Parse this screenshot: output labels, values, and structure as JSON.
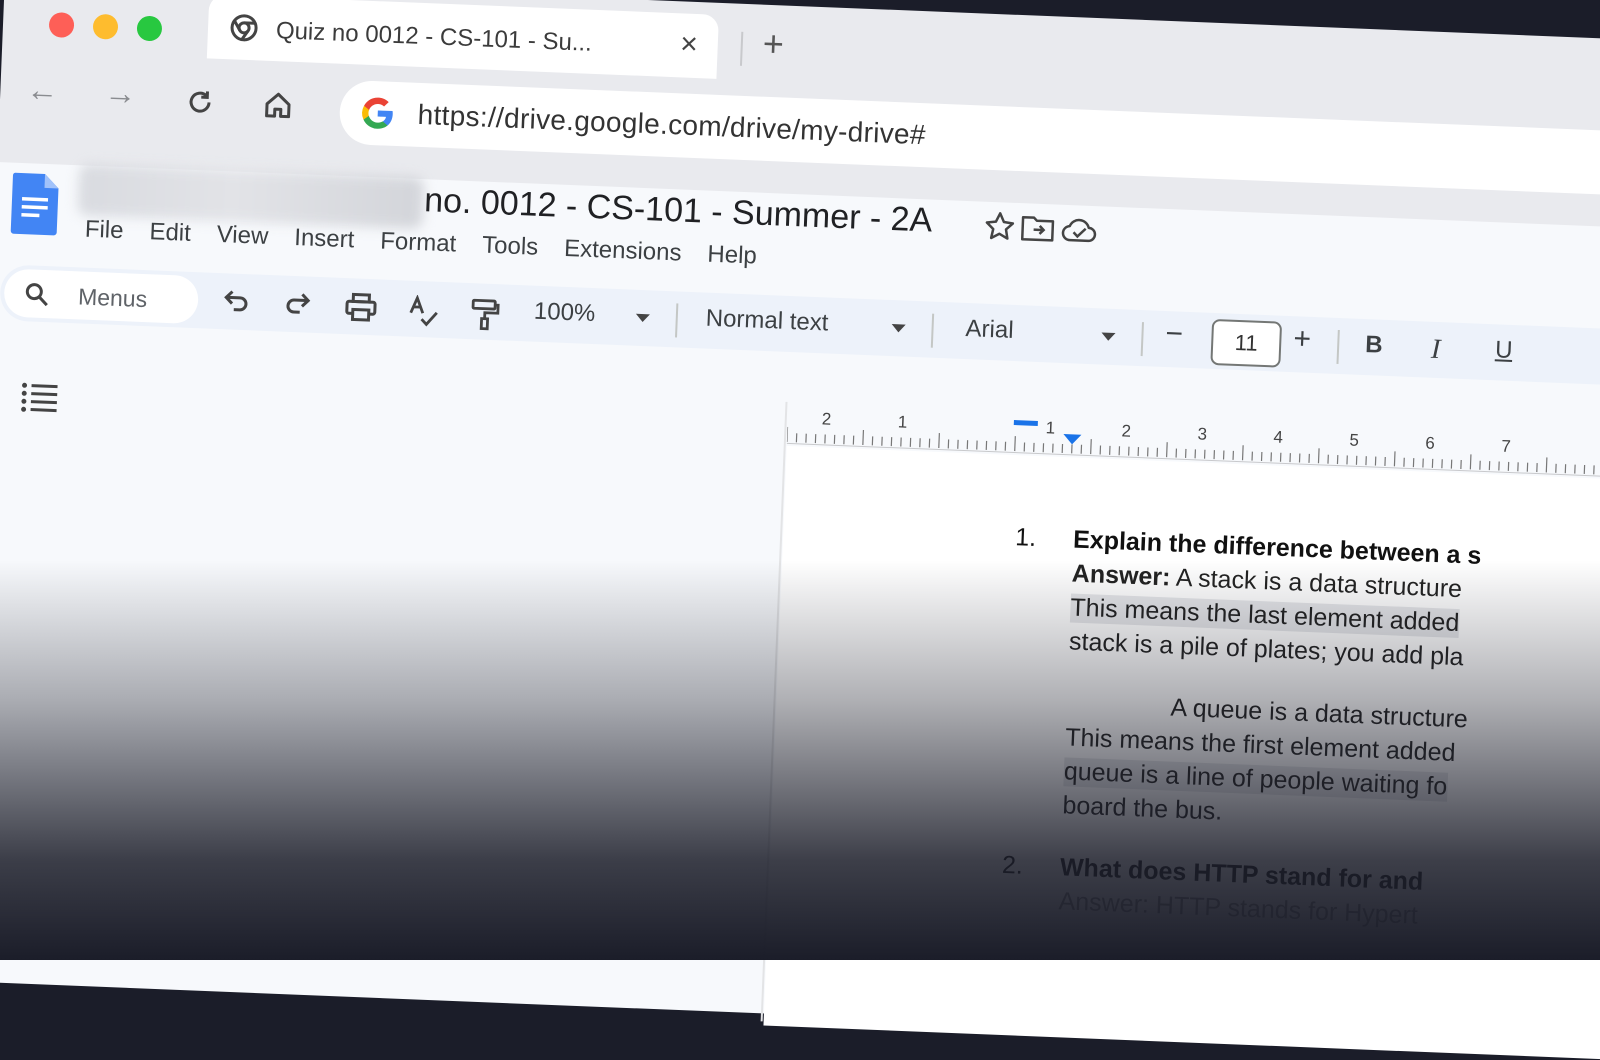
{
  "browser": {
    "tab_title": "Quiz no 0012 - CS-101 - Su...",
    "tab_close": "×",
    "new_tab": "+",
    "back": "←",
    "forward": "→",
    "url": "https://drive.google.com/drive/my-drive#"
  },
  "doc": {
    "title": "no. 0012 - CS-101 - Summer - 2A",
    "menu": [
      "File",
      "Edit",
      "View",
      "Insert",
      "Format",
      "Tools",
      "Extensions",
      "Help"
    ]
  },
  "toolbar": {
    "menus_label": "Menus",
    "zoom": "100%",
    "style": "Normal text",
    "font": "Arial",
    "font_size": "11",
    "minus": "−",
    "plus": "+",
    "bold": "B",
    "italic": "I",
    "underline": "U"
  },
  "ruler": {
    "labels": [
      "2",
      "1",
      "1",
      "2",
      "3",
      "4",
      "5",
      "6",
      "7"
    ]
  },
  "content": {
    "q1_number": "1.",
    "q1_text": "Explain the difference between a s",
    "answer_label": "Answer:",
    "q1_line1": " A stack is a data structure",
    "q1_line2": "This means the last element added",
    "q1_line3": "stack is a pile of plates; you add pla",
    "q1_line4": "A queue is a data structure",
    "q1_line5": "This means the first element added",
    "q1_line6": "queue is a line of people waiting fo",
    "q1_line7": "board the bus.",
    "q2_number": "2.",
    "q2_text": "What does HTTP stand for and",
    "q2_answer": "Answer: HTTP stands for Hypert"
  },
  "colors": {
    "background": "#1b1d29",
    "docs_blue": "#4285f4",
    "toolbar_bg": "#edf2fa"
  },
  "icons": [
    "chrome-icon",
    "reload-icon",
    "home-icon",
    "google-icon",
    "docs-icon",
    "star-icon",
    "move-folder-icon",
    "cloud-icon",
    "search-icon",
    "undo-icon",
    "redo-icon",
    "print-icon",
    "spellcheck-icon",
    "paint-format-icon",
    "outline-icon"
  ]
}
